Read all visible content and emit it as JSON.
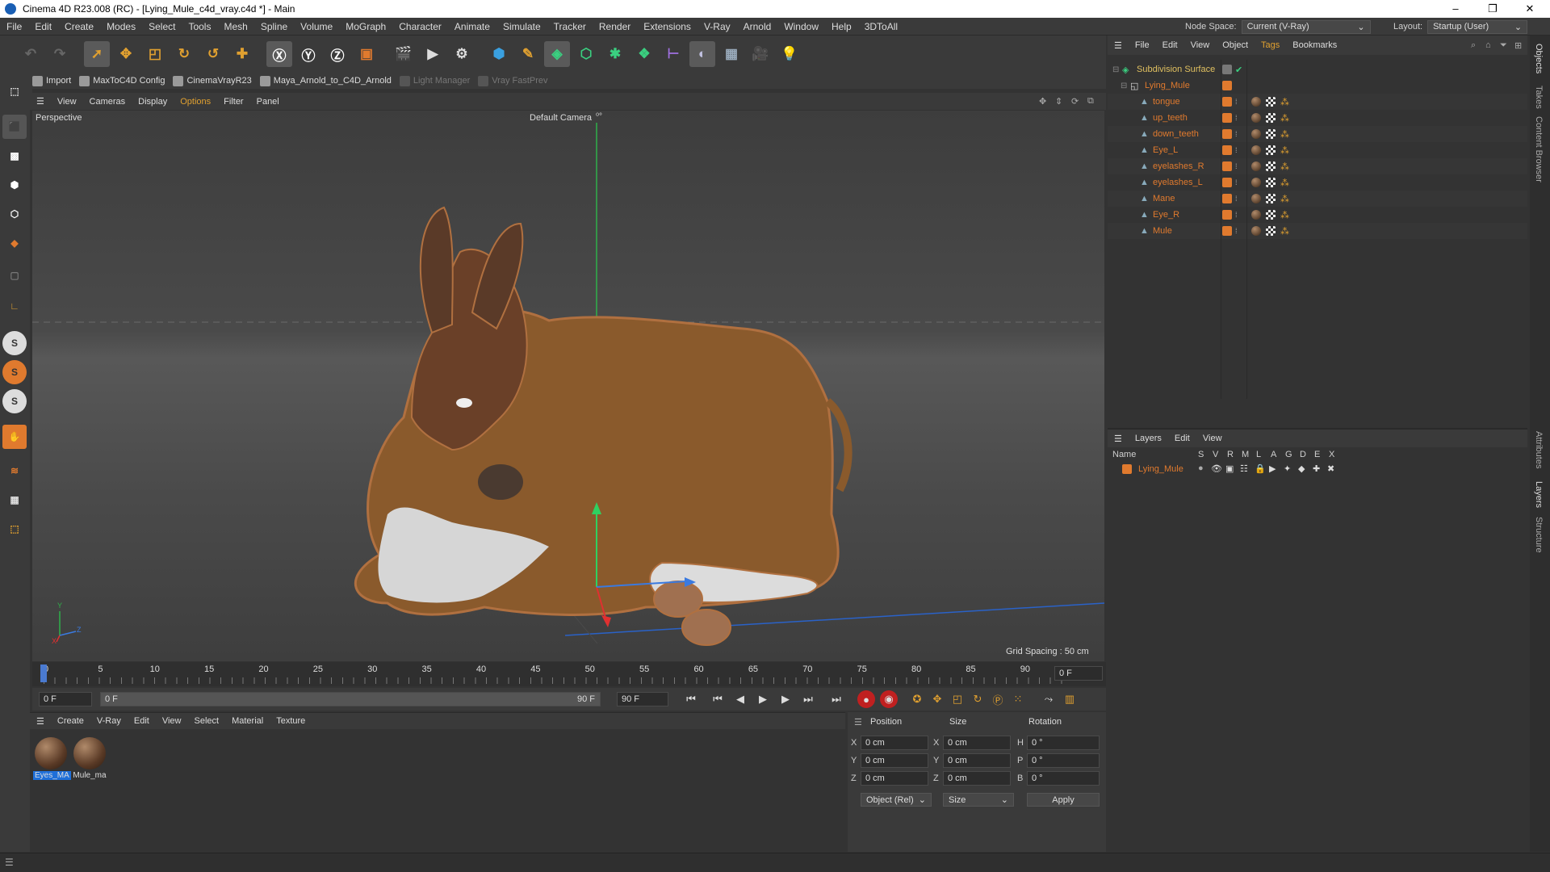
{
  "window": {
    "title": "Cinema 4D R23.008 (RC) - [Lying_Mule_c4d_vray.c4d *] - Main",
    "min": "–",
    "max": "❐",
    "close": "✕"
  },
  "menu": {
    "items": [
      "File",
      "Edit",
      "Create",
      "Modes",
      "Select",
      "Tools",
      "Mesh",
      "Spline",
      "Volume",
      "MoGraph",
      "Character",
      "Animate",
      "Simulate",
      "Tracker",
      "Render",
      "Extensions",
      "V-Ray",
      "Arnold",
      "Window",
      "Help",
      "3DToAll"
    ],
    "node_space_label": "Node Space:",
    "node_space_value": "Current (V-Ray)",
    "layout_label": "Layout:",
    "layout_value": "Startup (User)"
  },
  "plugins": {
    "items": [
      "Import",
      "MaxToC4D Config",
      "CinemaVrayR23",
      "Maya_Arnold_to_C4D_Arnold",
      "Light Manager",
      "Vray FastPrev"
    ]
  },
  "viewport": {
    "menu": [
      "View",
      "Cameras",
      "Display",
      "Options",
      "Filter",
      "Panel"
    ],
    "view_name": "Perspective",
    "camera": "Default Camera",
    "camera_icon": "⁰°",
    "grid_spacing": "Grid Spacing : 50 cm",
    "axis_y": "Y",
    "axis_x": "X",
    "axis_z": "Z"
  },
  "timeline": {
    "ticks": [
      "0",
      "5",
      "10",
      "15",
      "20",
      "25",
      "30",
      "35",
      "40",
      "45",
      "50",
      "55",
      "60",
      "65",
      "70",
      "75",
      "80",
      "85",
      "90"
    ],
    "current_frame_right": "0 F",
    "start": "0 F",
    "preview_start": "0 F",
    "preview_end": "90 F",
    "end": "90 F"
  },
  "materials": {
    "menu": [
      "Create",
      "V-Ray",
      "Edit",
      "View",
      "Select",
      "Material",
      "Texture"
    ],
    "items": [
      "Eyes_MA",
      "Mule_ma"
    ]
  },
  "attributes": {
    "headers": [
      "Position",
      "Size",
      "Rotation"
    ],
    "pos": [
      {
        "axis": "X",
        "value": "0 cm"
      },
      {
        "axis": "Y",
        "value": "0 cm"
      },
      {
        "axis": "Z",
        "value": "0 cm"
      }
    ],
    "size": [
      {
        "axis": "X",
        "value": "0 cm"
      },
      {
        "axis": "Y",
        "value": "0 cm"
      },
      {
        "axis": "Z",
        "value": "0 cm"
      }
    ],
    "rot": [
      {
        "axis": "H",
        "value": "0 °"
      },
      {
        "axis": "P",
        "value": "0 °"
      },
      {
        "axis": "B",
        "value": "0 °"
      }
    ],
    "coord_mode": "Object (Rel)",
    "size_mode": "Size",
    "apply": "Apply"
  },
  "objects": {
    "menu": [
      "File",
      "Edit",
      "View",
      "Object",
      "Tags",
      "Bookmarks"
    ],
    "root": "Subdivision Surface",
    "group": "Lying_Mule",
    "children": [
      "tongue",
      "up_teeth",
      "down_teeth",
      "Eye_L",
      "eyelashes_R",
      "eyelashes_L",
      "Mane",
      "Eye_R",
      "Mule"
    ]
  },
  "layers": {
    "menu": [
      "Layers",
      "Edit",
      "View"
    ],
    "col_name": "Name",
    "cols": [
      "S",
      "V",
      "R",
      "M",
      "L",
      "A",
      "G",
      "D",
      "E",
      "X"
    ],
    "rows": [
      {
        "name": "Lying_Mule",
        "color": "#e07a2e"
      }
    ]
  },
  "sidetabs": [
    "Objects",
    "Takes",
    "Content Browser",
    "Attributes",
    "Layers",
    "Structure"
  ],
  "colors": {
    "accent": "#e07a2e",
    "bg": "#333333",
    "panel": "#3a3a3a",
    "selected_blue": "#1e6fd9"
  }
}
